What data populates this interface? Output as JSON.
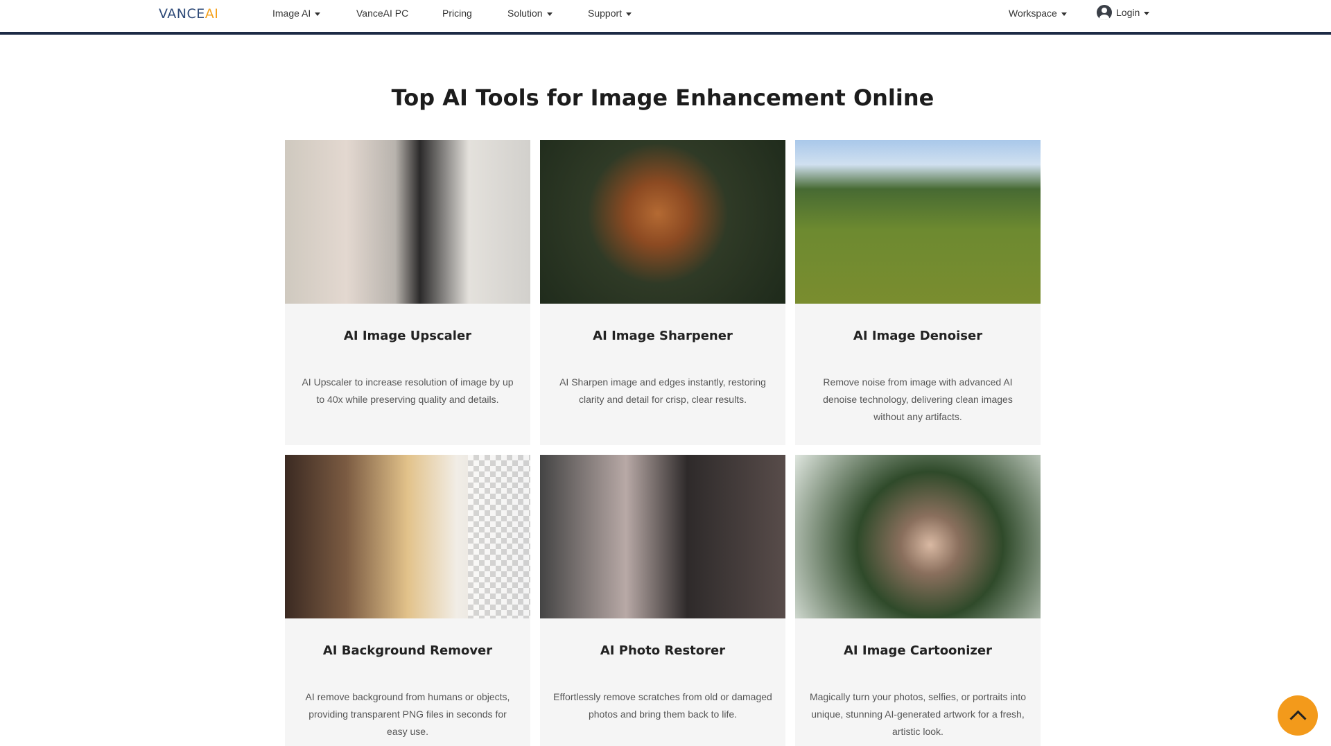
{
  "nav": {
    "logo_part1": "VANCE",
    "logo_part2": "AI",
    "items": [
      {
        "label": "Image AI"
      },
      {
        "label": "VanceAI PC"
      },
      {
        "label": "Pricing"
      },
      {
        "label": "Solution"
      },
      {
        "label": "Support"
      }
    ],
    "workspace": "Workspace",
    "login": "Login",
    "icons": {
      "user": "user-circle-icon",
      "dropdown": "caret-down-icon"
    }
  },
  "main": {
    "heading": "Top AI Tools for Image Enhancement Online",
    "cards": [
      {
        "title": "AI Image Upscaler",
        "desc": "AI Upscaler to increase resolution of image by up to 40x while preserving quality and details."
      },
      {
        "title": "AI Image Sharpener",
        "desc": "AI Sharpen image and edges instantly, restoring clarity and detail for crisp, clear results."
      },
      {
        "title": "AI Image Denoiser",
        "desc": "Remove noise from image with advanced AI denoise technology, delivering clean images without any artifacts."
      },
      {
        "title": "AI Background Remover",
        "desc": "AI remove background from humans or objects, providing transparent PNG files in seconds for easy use."
      },
      {
        "title": "AI Photo Restorer",
        "desc": "Effortlessly remove scratches from old or damaged photos and bring them back to life."
      },
      {
        "title": "AI Image Cartoonizer",
        "desc": "Magically turn your photos, selfies, or portraits into unique, stunning AI-generated artwork for a fresh, artistic look."
      }
    ]
  },
  "scroll_top": {
    "icon": "chevron-up-icon",
    "color": "#f39a1b"
  }
}
